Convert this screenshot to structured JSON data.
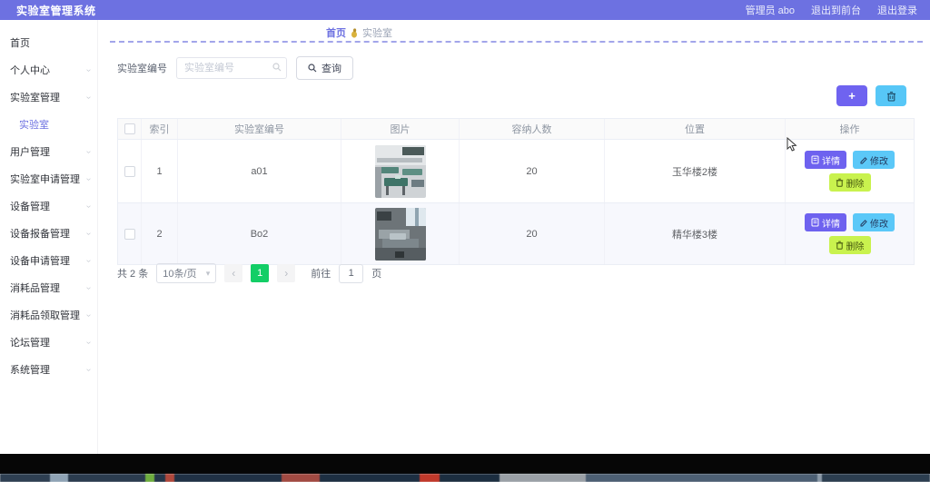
{
  "header": {
    "title": "实验室管理系统",
    "user_label": "管理员 abo",
    "logout_front": "退出到前台",
    "logout": "退出登录"
  },
  "sidebar": {
    "items": [
      {
        "label": "首页"
      },
      {
        "label": "个人中心",
        "chevron": "›"
      },
      {
        "label": "实验室管理",
        "chevron": "›"
      },
      {
        "label": "实验室",
        "active": true
      },
      {
        "label": "用户管理",
        "chevron": "›"
      },
      {
        "label": "实验室申请管理",
        "chevron": "›"
      },
      {
        "label": "设备管理",
        "chevron": "›"
      },
      {
        "label": "设备报备管理",
        "chevron": "›"
      },
      {
        "label": "设备申请管理",
        "chevron": "›"
      },
      {
        "label": "消耗品管理",
        "chevron": "›"
      },
      {
        "label": "消耗品领取管理",
        "chevron": "›"
      },
      {
        "label": "论坛管理",
        "chevron": "›"
      },
      {
        "label": "系统管理",
        "chevron": "›"
      }
    ]
  },
  "breadcrumb": {
    "home": "首页",
    "current": "实验室"
  },
  "search": {
    "label": "实验室编号",
    "placeholder": "实验室编号",
    "button": "查询"
  },
  "toolbar": {
    "add_label": "+",
    "delete_icon": "trash-icon"
  },
  "table": {
    "headers": {
      "index": "索引",
      "code": "实验室编号",
      "image": "图片",
      "capacity": "容纳人数",
      "location": "位置",
      "actions": "操作"
    },
    "rows": [
      {
        "index": "1",
        "code": "a01",
        "capacity": "20",
        "location": "玉华楼2楼",
        "image_alt": "lab-photo-1"
      },
      {
        "index": "2",
        "code": "Bo2",
        "capacity": "20",
        "location": "精华楼3楼",
        "image_alt": "lab-photo-2"
      }
    ],
    "action_labels": {
      "detail": "详情",
      "edit": "修改",
      "delete": "删除"
    }
  },
  "pagination": {
    "total": "共 2 条",
    "page_size": "10条/页",
    "size_arrow": "▾",
    "prev": "‹",
    "page": "1",
    "next": "›",
    "goto_label": "前往",
    "goto_value": "1",
    "goto_unit": "页"
  },
  "colors": {
    "primary": "#6d71e1",
    "detail_button": "#6e62ef",
    "edit_button": "#5bc8f8",
    "delete_button": "#c9f24e",
    "pager_active": "#13ce66"
  }
}
